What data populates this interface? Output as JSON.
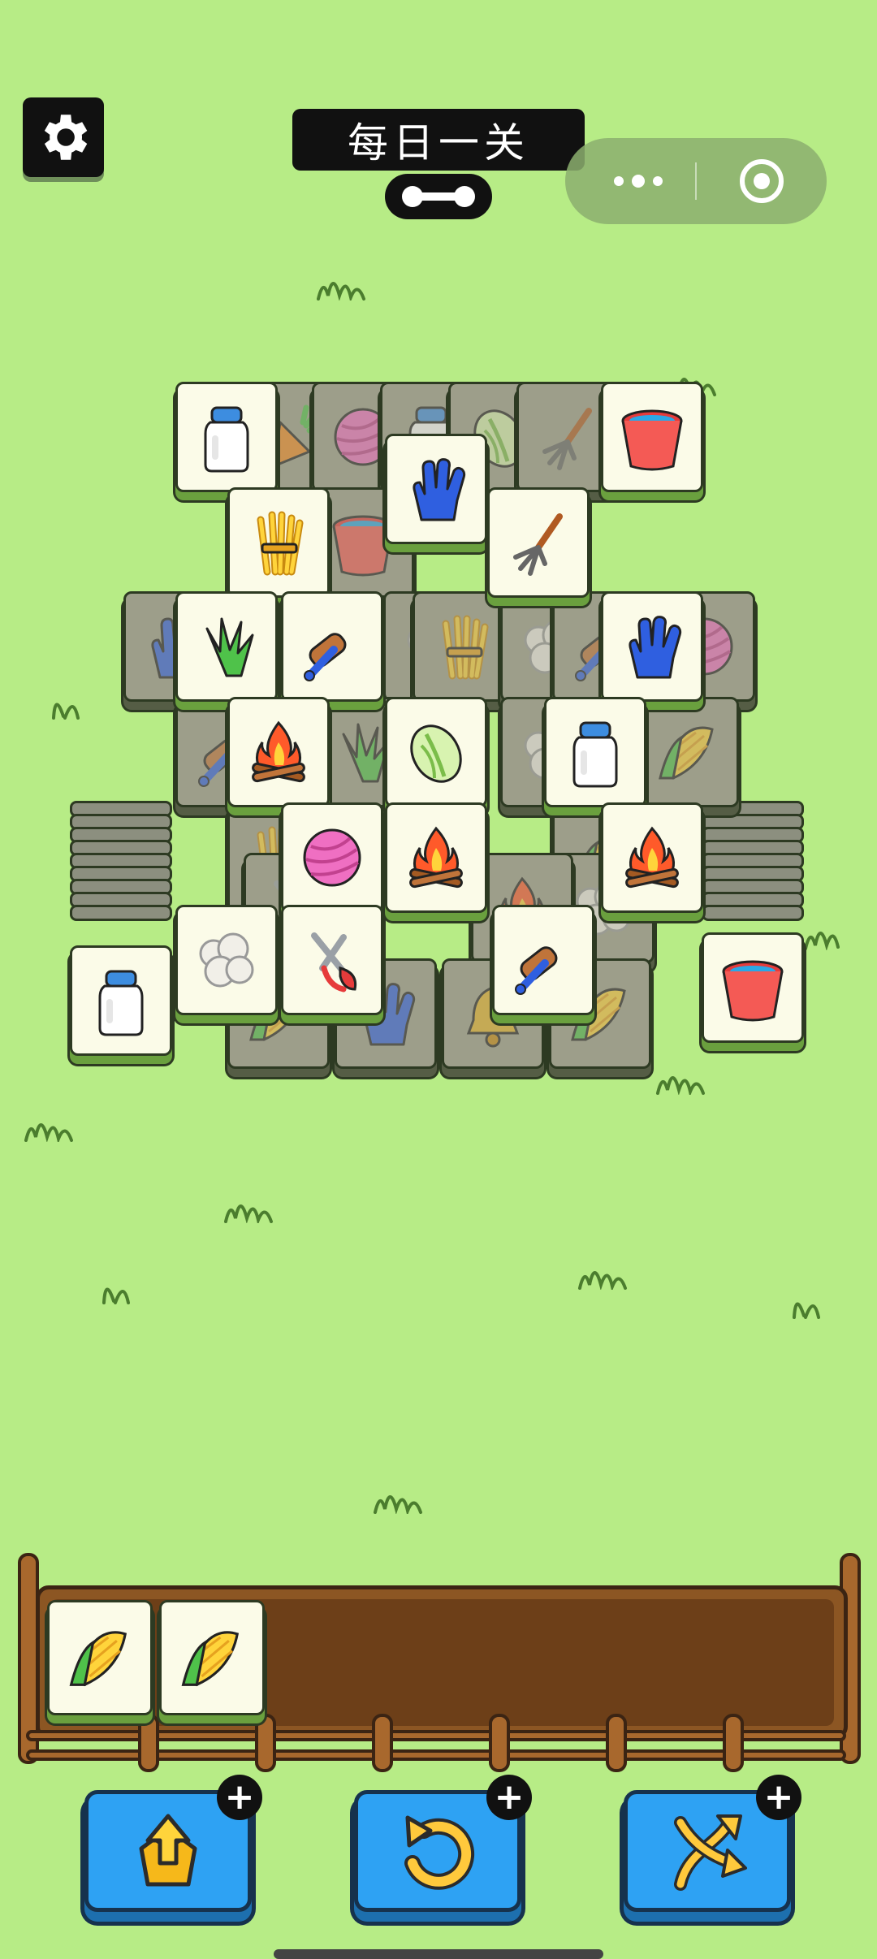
{
  "header": {
    "title": "每日一关",
    "settings_icon": "gear-icon",
    "progress_icon": "bone-progress-icon"
  },
  "capsule": {
    "more_icon": "more-dots-icon",
    "close_icon": "target-close-icon"
  },
  "colors": {
    "background": "#b7ec86",
    "tile_face": "#fbfbe8",
    "tile_edge": "#6aa03e",
    "tool_button": "#2ea2f3",
    "tray_wood": "#8c5623"
  },
  "board": {
    "tiles": [
      {
        "item": "carrot",
        "state": "blocked"
      },
      {
        "item": "yarn",
        "state": "blocked"
      },
      {
        "item": "milk",
        "state": "blocked"
      },
      {
        "item": "cabbage",
        "state": "blocked"
      },
      {
        "item": "pitchfork",
        "state": "blocked"
      },
      {
        "item": "milk",
        "state": "free"
      },
      {
        "item": "bucket",
        "state": "free"
      },
      {
        "item": "bucket",
        "state": "blocked"
      },
      {
        "item": "wheat",
        "state": "free"
      },
      {
        "item": "glove",
        "state": "free"
      },
      {
        "item": "pitchfork",
        "state": "free"
      },
      {
        "item": "glove",
        "state": "blocked"
      },
      {
        "item": "wool",
        "state": "blocked"
      },
      {
        "item": "wheat",
        "state": "blocked"
      },
      {
        "item": "wool",
        "state": "blocked"
      },
      {
        "item": "brush",
        "state": "blocked"
      },
      {
        "item": "yarn",
        "state": "blocked"
      },
      {
        "item": "grass",
        "state": "free"
      },
      {
        "item": "brush",
        "state": "free"
      },
      {
        "item": "glove",
        "state": "free"
      },
      {
        "item": "brush",
        "state": "blocked"
      },
      {
        "item": "grass",
        "state": "blocked"
      },
      {
        "item": "wool",
        "state": "blocked"
      },
      {
        "item": "corn",
        "state": "blocked"
      },
      {
        "item": "campfire",
        "state": "free"
      },
      {
        "item": "cabbage",
        "state": "free"
      },
      {
        "item": "milk",
        "state": "free"
      },
      {
        "item": "wheat",
        "state": "blocked"
      },
      {
        "item": "corn",
        "state": "blocked"
      },
      {
        "item": "wool",
        "state": "blocked"
      },
      {
        "item": "campfire",
        "state": "blocked"
      },
      {
        "item": "shears",
        "state": "blocked"
      },
      {
        "item": "yarn",
        "state": "free"
      },
      {
        "item": "campfire",
        "state": "free"
      },
      {
        "item": "campfire",
        "state": "free"
      },
      {
        "item": "corn",
        "state": "blocked"
      },
      {
        "item": "glove",
        "state": "blocked"
      },
      {
        "item": "bell",
        "state": "blocked"
      },
      {
        "item": "corn",
        "state": "blocked"
      },
      {
        "item": "wool",
        "state": "free"
      },
      {
        "item": "shears",
        "state": "free"
      },
      {
        "item": "brush",
        "state": "free"
      },
      {
        "item": "milk",
        "state": "free"
      },
      {
        "item": "bucket",
        "state": "free"
      }
    ],
    "left_stack_count": 9,
    "right_stack_count": 9
  },
  "tray": {
    "slots": [
      {
        "item": "corn"
      },
      {
        "item": "corn"
      }
    ],
    "capacity": 7
  },
  "tools": [
    {
      "name": "move-out",
      "icon": "move-out-icon",
      "badge": "+"
    },
    {
      "name": "undo",
      "icon": "undo-icon",
      "badge": "+"
    },
    {
      "name": "shuffle",
      "icon": "shuffle-icon",
      "badge": "+"
    }
  ]
}
